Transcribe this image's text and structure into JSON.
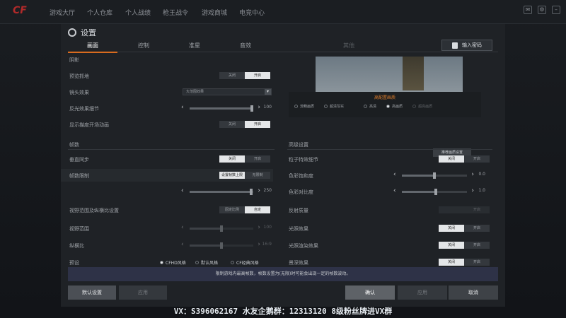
{
  "nav": {
    "items": [
      "游戏大厅",
      "个人仓库",
      "个人战绩",
      "枪王战令",
      "游戏商城",
      "电竞中心"
    ]
  },
  "settings": {
    "title": "设置",
    "tabs": [
      "画面",
      "控制",
      "准星",
      "音效",
      "其他"
    ],
    "input_code_label": "输入密码"
  },
  "left": {
    "rows": [
      {
        "label": "阴影"
      },
      {
        "label": "预览抓地",
        "toggle": [
          "关闭",
          "开启"
        ]
      },
      {
        "label": "镜头效果",
        "dropdown": "大范围效果"
      },
      {
        "label": "反光效果细节",
        "slider_value": "100"
      },
      {
        "label": "显示描度开场动画",
        "toggle": [
          "关闭",
          "开启"
        ]
      }
    ],
    "frame_section": "帧数",
    "frame_rows": [
      {
        "label": "垂直同步",
        "toggle": [
          "关闭",
          "开启"
        ]
      },
      {
        "label": "帧数限制",
        "toggle": [
          "设置帧数上限",
          "无限制"
        ]
      },
      {
        "label": "",
        "slider_value": "250"
      },
      {
        "label": "视野范围及纵横比设置",
        "toggle": [
          "固定比例",
          "自定"
        ]
      },
      {
        "label": "视野范围",
        "slider_value": "100"
      },
      {
        "label": "纵横比",
        "slider_value": "16:9"
      },
      {
        "label": "预设",
        "radios": [
          "CFHD风格",
          "默认风格",
          "CF经典风格"
        ]
      }
    ]
  },
  "right": {
    "preview_quality_title": "高配置画质",
    "quality_options": [
      "流畅画质",
      "超清写实",
      "高清",
      "高画质",
      "超高画质"
    ],
    "selected_quality": "高画质",
    "recommend_button": "推荐画质设置",
    "advanced_section": "高级设置",
    "rows": [
      {
        "label": "粒子特效细节",
        "toggle": [
          "关闭",
          "开启"
        ]
      },
      {
        "label": "色彩饱和度",
        "slider_value": "0.0"
      },
      {
        "label": "色彩对比度",
        "slider_value": "1.0"
      },
      {
        "label": "反射质量",
        "toggle": [
          "",
          "开启"
        ]
      },
      {
        "label": "光照效果",
        "toggle": [
          "关闭",
          "开启"
        ]
      },
      {
        "label": "光照渲染效果",
        "toggle": [
          "关闭",
          "开启"
        ]
      },
      {
        "label": "景深效果",
        "toggle": [
          "关闭",
          "开启"
        ]
      }
    ]
  },
  "hint_text": "限制游戏内最高帧数，帧数设置为(无限)时可能会出现一定的帧数波动。",
  "buttons": {
    "default": "默认设置",
    "apply": "应用",
    "ok": "确认",
    "apply2": "应用",
    "cancel": "取消"
  },
  "banner": "VX：S396062167 水友企鹅群：12313120  8级粉丝牌进VX群"
}
